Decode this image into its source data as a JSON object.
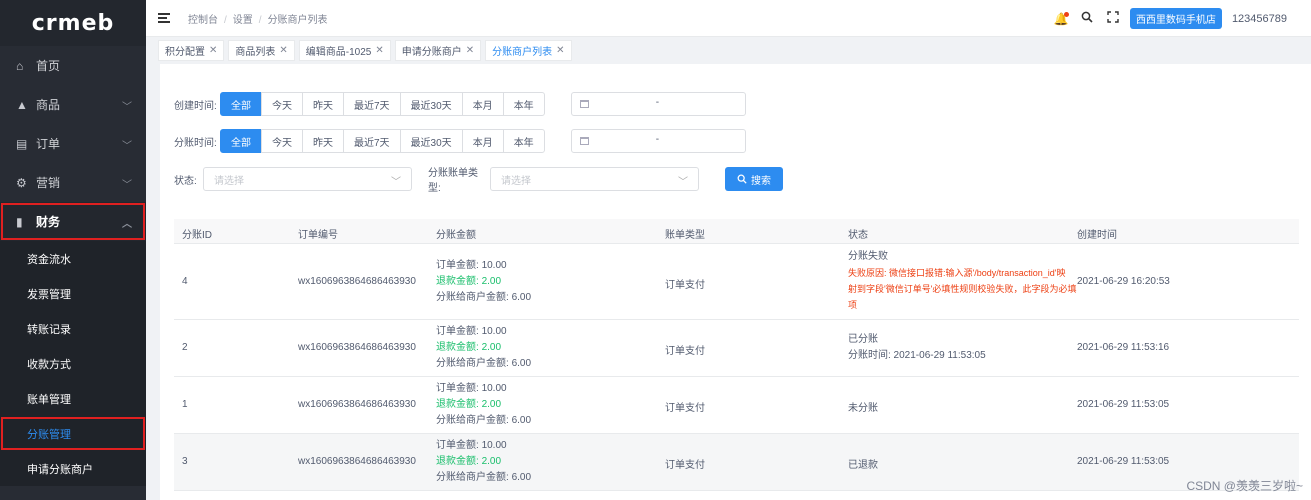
{
  "app": {
    "logo_text": "crmeb"
  },
  "sidebar": {
    "menus": [
      {
        "label": "首页",
        "icon": "home-icon",
        "glyph": "⌂"
      },
      {
        "label": "商品",
        "icon": "goods-icon",
        "glyph": "▲"
      },
      {
        "label": "订单",
        "icon": "order-icon",
        "glyph": "▤"
      },
      {
        "label": "营销",
        "icon": "marketing-icon",
        "glyph": "⚙"
      },
      {
        "label": "财务",
        "icon": "finance-icon",
        "glyph": "▮"
      }
    ],
    "finance_sub": [
      {
        "label": "资金流水"
      },
      {
        "label": "发票管理"
      },
      {
        "label": "转账记录"
      },
      {
        "label": "收款方式"
      },
      {
        "label": "账单管理"
      },
      {
        "label": "分账管理"
      },
      {
        "label": "申请分账商户"
      }
    ]
  },
  "header": {
    "breadcrumb": [
      "控制台",
      "设置",
      "分账商户列表"
    ],
    "store_name": "西西里数码手机店",
    "username": "123456789"
  },
  "tags": [
    {
      "label": "积分配置"
    },
    {
      "label": "商品列表"
    },
    {
      "label": "编辑商品-1025"
    },
    {
      "label": "申请分账商户"
    },
    {
      "label": "分账商户列表"
    }
  ],
  "filters": {
    "create_label": "创建时间:",
    "split_label": "分账时间:",
    "periods": [
      "全部",
      "今天",
      "昨天",
      "最近7天",
      "最近30天",
      "本月",
      "本年"
    ],
    "date_dash": "-",
    "status_label": "状态:",
    "status_placeholder": "请选择",
    "bill_type_label": "分账账单类型:",
    "bill_type_placeholder": "请选择",
    "search_label": "搜索"
  },
  "table": {
    "headers": [
      "分账ID",
      "订单编号",
      "分账金额",
      "账单类型",
      "状态",
      "创建时间"
    ],
    "amount_labels": {
      "order": "订单金额:",
      "refund": "退款金额:",
      "merchant": "分账给商户金额:"
    },
    "rows": [
      {
        "id": "4",
        "order_no": "wx1606963864686463930",
        "order_amount": "10.00",
        "refund_amount": "2.00",
        "merchant_amount": "6.00",
        "bill_type": "订单支付",
        "status": "分账失败",
        "status_detail_1": "失败原因: 微信接口报错:输入源'/body/transaction_id'映",
        "status_detail_2": "射到字段'微信订单号'必填性规则校验失败，此字段为必填",
        "status_detail_3": "项",
        "created": "2021-06-29 16:20:53"
      },
      {
        "id": "2",
        "order_no": "wx1606963864686463930",
        "order_amount": "10.00",
        "refund_amount": "2.00",
        "merchant_amount": "6.00",
        "bill_type": "订单支付",
        "status": "已分账",
        "status_detail_1": "分账时间: 2021-06-29 11:53:05",
        "created": "2021-06-29 11:53:16"
      },
      {
        "id": "1",
        "order_no": "wx1606963864686463930",
        "order_amount": "10.00",
        "refund_amount": "2.00",
        "merchant_amount": "6.00",
        "bill_type": "订单支付",
        "status": "未分账",
        "created": "2021-06-29 11:53:05"
      },
      {
        "id": "3",
        "order_no": "wx1606963864686463930",
        "order_amount": "10.00",
        "refund_amount": "2.00",
        "merchant_amount": "6.00",
        "bill_type": "订单支付",
        "status": "已退款",
        "created": "2021-06-29 11:53:05"
      }
    ]
  },
  "watermark": "CSDN @羡羡三岁啦~",
  "colors": {
    "primary": "#2d8cf0",
    "sidebar_bg": "#282c34",
    "success": "#19be6b",
    "error": "#ed4014",
    "highlight_box": "#e02020"
  }
}
